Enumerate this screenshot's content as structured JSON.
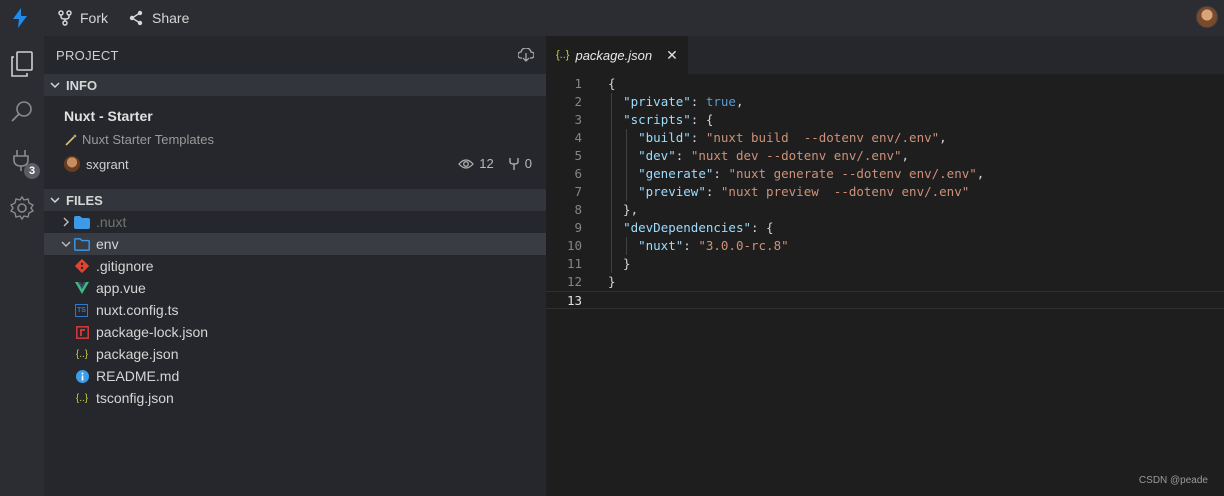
{
  "topbar": {
    "fork_label": "Fork",
    "share_label": "Share"
  },
  "activity": {
    "extensions_badge": "3"
  },
  "sidebar": {
    "title": "PROJECT",
    "info_header": "INFO",
    "project_name": "Nuxt - Starter",
    "project_description": "Nuxt Starter Templates",
    "username": "sxgrant",
    "views": "12",
    "forks": "0",
    "files_header": "FILES",
    "files": [
      {
        "name": ".nuxt",
        "icon": "folder-icon"
      },
      {
        "name": "env",
        "icon": "folder-open-icon"
      },
      {
        "name": ".gitignore",
        "icon": "git-icon"
      },
      {
        "name": "app.vue",
        "icon": "vue-icon"
      },
      {
        "name": "nuxt.config.ts",
        "icon": "typescript-icon"
      },
      {
        "name": "package-lock.json",
        "icon": "npm-icon"
      },
      {
        "name": "package.json",
        "icon": "json-icon"
      },
      {
        "name": "README.md",
        "icon": "info-icon"
      },
      {
        "name": "tsconfig.json",
        "icon": "json-icon"
      }
    ]
  },
  "editor": {
    "tab_label": "package.json",
    "tab_icon": "{..}",
    "line_numbers": [
      "1",
      "2",
      "3",
      "4",
      "5",
      "6",
      "7",
      "8",
      "9",
      "10",
      "11",
      "12",
      "13"
    ],
    "code": {
      "l1": "{",
      "private_key": "\"private\"",
      "private_val": "true",
      "scripts_key": "\"scripts\"",
      "build_key": "\"build\"",
      "build_val": "\"nuxt build  --dotenv env/.env\"",
      "dev_key": "\"dev\"",
      "dev_val": "\"nuxt dev --dotenv env/.env\"",
      "generate_key": "\"generate\"",
      "generate_val": "\"nuxt generate --dotenv env/.env\"",
      "preview_key": "\"preview\"",
      "preview_val": "\"nuxt preview  --dotenv env/.env\"",
      "devdeps_key": "\"devDependencies\"",
      "nuxt_key": "\"nuxt\"",
      "nuxt_val": "\"3.0.0-rc.8\""
    }
  },
  "watermark": "CSDN @peade",
  "colors": {
    "accent": "#3c9ee8",
    "json_key": "#9cdcfe",
    "json_string": "#ce9178",
    "json_bool": "#569cd6"
  }
}
